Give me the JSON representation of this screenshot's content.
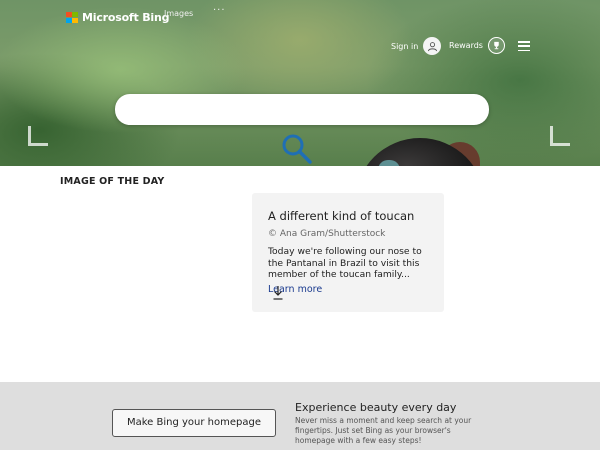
{
  "header": {
    "logo_text": "Microsoft Bing",
    "logo_colors": [
      "#f25022",
      "#7fba00",
      "#00a4ef",
      "#ffb900"
    ],
    "nav": {
      "images": "Images",
      "more": "···"
    },
    "signin_label": "Sign in",
    "rewards_label": "Rewards"
  },
  "search": {
    "placeholder": ""
  },
  "image_of_day": {
    "heading": "IMAGE OF THE DAY",
    "title": "A different kind of toucan",
    "credit": "© Ana Gram/Shutterstock",
    "description": "Today we're following our nose to the Pantanal in Brazil to visit this member of the toucan family...",
    "link": "Learn more"
  },
  "promo": {
    "button_label": "Make Bing your homepage",
    "title": "Experience beauty every day",
    "description": "Never miss a moment and keep search at your fingertips. Just set Bing as your browser's homepage with a few easy steps!"
  },
  "colors": {
    "accent": "#1a3a8e",
    "search_icon": "#1f6fb5"
  }
}
